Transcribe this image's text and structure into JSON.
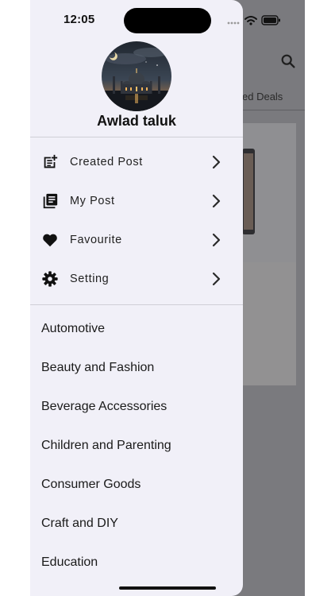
{
  "status_bar": {
    "time": "12:05"
  },
  "profile": {
    "name": "Awlad taluk"
  },
  "menu": [
    {
      "label": "Created Post",
      "icon": "post-add-icon"
    },
    {
      "label": "My Post",
      "icon": "library-books-icon"
    },
    {
      "label": "Favourite",
      "icon": "heart-icon"
    },
    {
      "label": "Setting",
      "icon": "gear-icon"
    }
  ],
  "categories": [
    {
      "label": "Automotive"
    },
    {
      "label": "Beauty and Fashion"
    },
    {
      "label": "Beverage Accessories"
    },
    {
      "label": "Children and Parenting"
    },
    {
      "label": "Consumer Goods"
    },
    {
      "label": "Craft and DIY"
    },
    {
      "label": "Education"
    }
  ],
  "background_app": {
    "tab_partial": "ed Deals"
  },
  "colors": {
    "drawer_bg": "#f1f0f8",
    "scrim": "#7a7a7e",
    "text": "#1a1a1a"
  }
}
